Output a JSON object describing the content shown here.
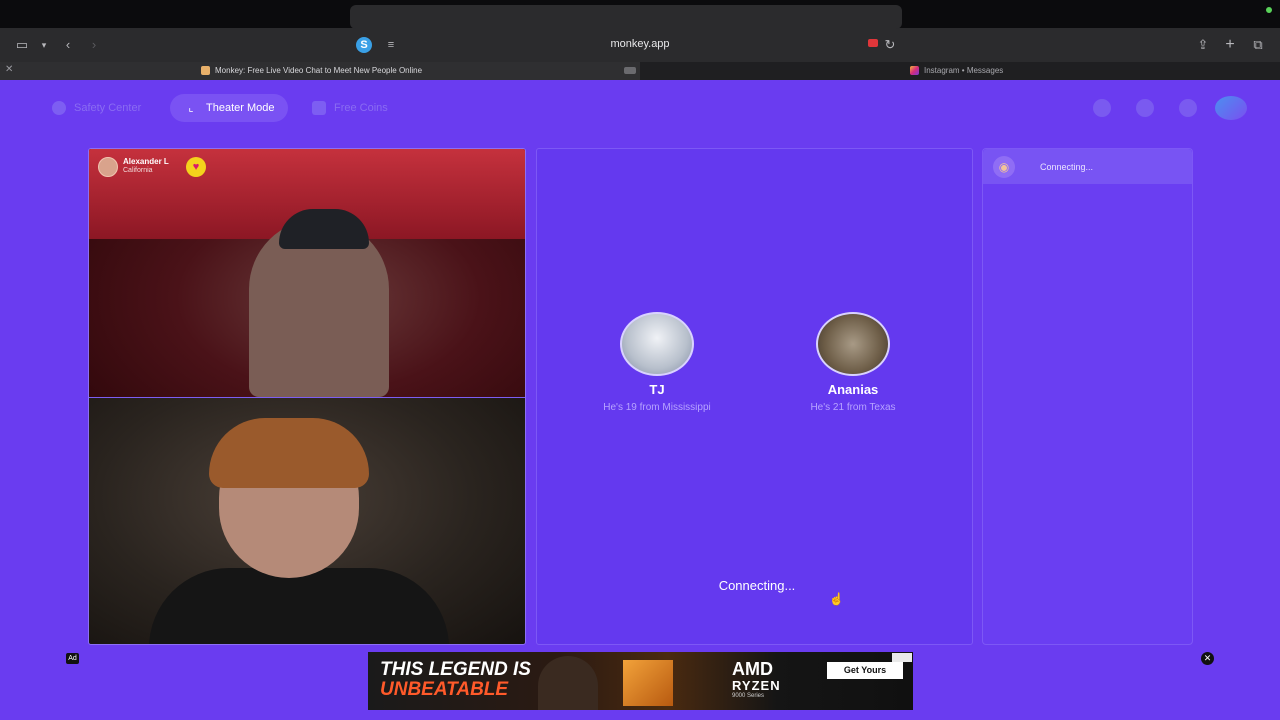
{
  "browser": {
    "url": "monkey.app",
    "tabs": [
      {
        "title": "Monkey: Free Live Video Chat to Meet New People Online"
      },
      {
        "title": "Instagram • Messages"
      }
    ]
  },
  "nav": {
    "safety_center": "Safety Center",
    "theater_mode": "Theater Mode",
    "free_coins": "Free Coins"
  },
  "video": {
    "user_name": "Alexander L",
    "user_location": "California"
  },
  "matches": [
    {
      "name": "TJ",
      "subtitle": "He's 19 from Mississippi"
    },
    {
      "name": "Ananias",
      "subtitle": "He's 21 from Texas"
    }
  ],
  "status": {
    "center_text": "Connecting...",
    "chat_text": "Connecting..."
  },
  "ad": {
    "label": "Ad",
    "headline_line1": "THIS LEGEND IS",
    "headline_line2": "UNBEATABLE",
    "brand": "AMD",
    "product": "RYZEN",
    "series": "9000 Series",
    "cta": "Get Yours"
  },
  "colors": {
    "page_background": "#6a3cf0",
    "accent_yellow": "#f4d21c",
    "recording_red": "#e0363a"
  }
}
